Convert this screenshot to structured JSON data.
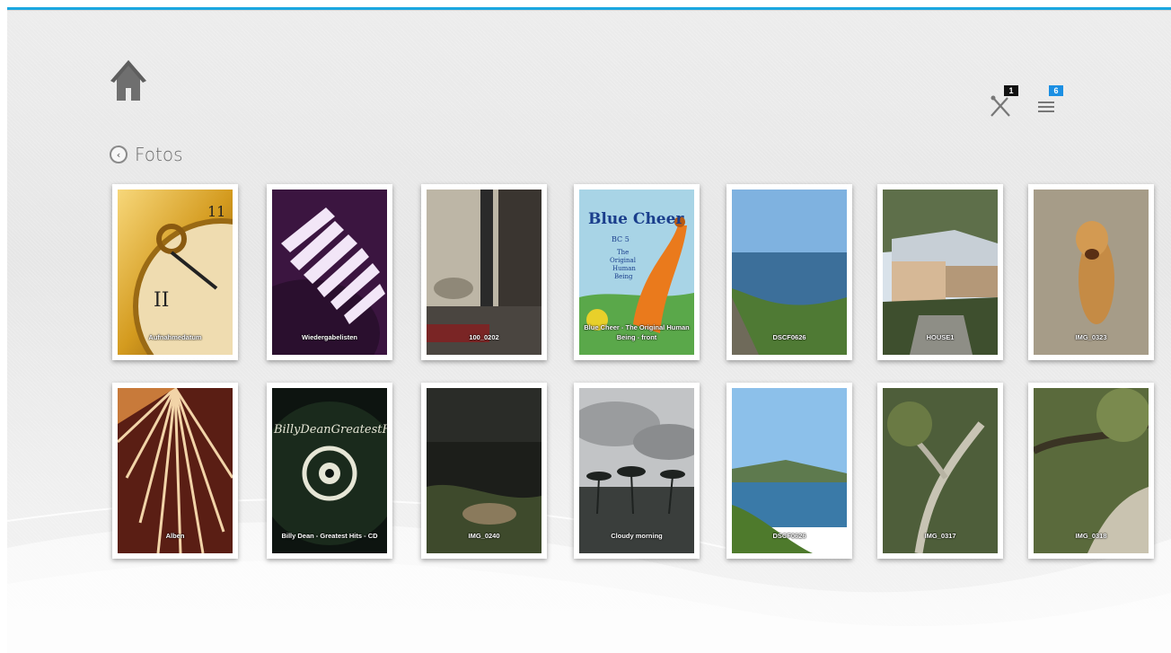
{
  "breadcrumb": {
    "label": "Fotos"
  },
  "status": {
    "tools_badge": "1",
    "queue_badge": "6"
  },
  "colors": {
    "accent": "#1aa7e0",
    "badge_queue": "#1b8fe3",
    "badge_tools": "#111111"
  },
  "tiles": [
    {
      "caption": "Aufnahmedatum",
      "kind": "folder"
    },
    {
      "caption": "Wiedergabelisten",
      "kind": "folder"
    },
    {
      "caption": "100_0202",
      "kind": "photo"
    },
    {
      "caption": "Blue Cheer - The Original Human Being - front",
      "kind": "photo"
    },
    {
      "caption": "DSCF0626",
      "kind": "photo"
    },
    {
      "caption": "HOUSE1",
      "kind": "photo"
    },
    {
      "caption": "IMG_0323",
      "kind": "photo"
    },
    {
      "caption": "Alben",
      "kind": "folder"
    },
    {
      "caption": "Billy Dean - Greatest Hits - CD",
      "kind": "photo"
    },
    {
      "caption": "IMG_0240",
      "kind": "photo"
    },
    {
      "caption": "Cloudy morning",
      "kind": "photo"
    },
    {
      "caption": "DSCF0626",
      "kind": "photo"
    },
    {
      "caption": "IMG_0317",
      "kind": "photo"
    },
    {
      "caption": "IMG_0318",
      "kind": "photo"
    }
  ],
  "art": {
    "blue_cheer_title": "Blue Cheer",
    "blue_cheer_sub1": "BC 5",
    "blue_cheer_sub2": "The",
    "blue_cheer_sub3": "Original",
    "blue_cheer_sub4": "Human",
    "blue_cheer_sub5": "Being",
    "billy_dean_text": "BillyDeanGreatestHits"
  }
}
